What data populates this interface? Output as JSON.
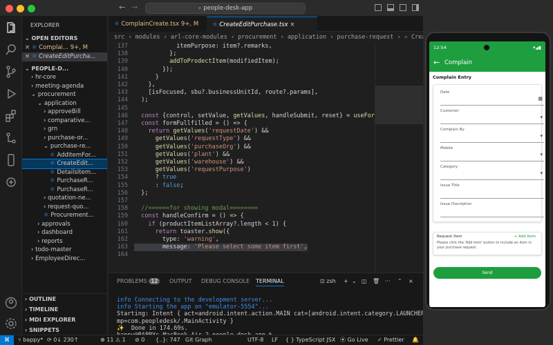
{
  "titlebar": {
    "search": "people-desk-app",
    "back": "←",
    "forward": "→"
  },
  "explorer": {
    "header": "EXPLORER",
    "open_editors": "OPEN EDITORS",
    "open_files": [
      {
        "name": "Complai...",
        "badge": "9+, M"
      },
      {
        "name": "CreateEditPurcha...",
        "badge": ""
      }
    ],
    "project": "PEOPLE-D...",
    "tree": [
      {
        "indent": 1,
        "icon": "›",
        "label": "hr-core"
      },
      {
        "indent": 1,
        "icon": "›",
        "label": "meeting-agenda"
      },
      {
        "indent": 1,
        "icon": "⌄",
        "label": "procurement"
      },
      {
        "indent": 2,
        "icon": "⌄",
        "label": "application"
      },
      {
        "indent": 3,
        "icon": "›",
        "label": "approveBill"
      },
      {
        "indent": 3,
        "icon": "›",
        "label": "comparative..."
      },
      {
        "indent": 3,
        "icon": "›",
        "label": "grn"
      },
      {
        "indent": 3,
        "icon": "›",
        "label": "purchase-or..."
      },
      {
        "indent": 3,
        "icon": "⌄",
        "label": "purchase-re..."
      },
      {
        "indent": 4,
        "icon": "",
        "label": "AddItemFor..."
      },
      {
        "indent": 4,
        "icon": "",
        "label": "CreateEdit..."
      },
      {
        "indent": 4,
        "icon": "",
        "label": "DetailsItem..."
      },
      {
        "indent": 4,
        "icon": "",
        "label": "PurchaseR..."
      },
      {
        "indent": 4,
        "icon": "",
        "label": "PurchaseR..."
      },
      {
        "indent": 3,
        "icon": "›",
        "label": "quotation-ne..."
      },
      {
        "indent": 3,
        "icon": "›",
        "label": "request-quo..."
      },
      {
        "indent": 3,
        "icon": "",
        "label": "Procurement..."
      },
      {
        "indent": 2,
        "icon": "›",
        "label": "approvals"
      },
      {
        "indent": 2,
        "icon": "›",
        "label": "dashboard"
      },
      {
        "indent": 2,
        "icon": "›",
        "label": "reports"
      },
      {
        "indent": 1,
        "icon": "›",
        "label": "todo-master"
      },
      {
        "indent": 1,
        "icon": "›",
        "label": "EmployeeDirec..."
      }
    ],
    "sections": [
      "OUTLINE",
      "TIMELINE",
      "MDI EXPLORER",
      "SNIPPETS"
    ]
  },
  "tabs": [
    {
      "label": "ComplainCreate.tsx",
      "badge": "9+, M"
    },
    {
      "label": "CreateEditPurchase.tsx",
      "badge": ""
    }
  ],
  "breadcrumb": [
    "src",
    "modules",
    "arl-core-modules",
    "procurement",
    "application",
    "purchase-request",
    "CreateEditPurchase..."
  ],
  "code": {
    "lines": [
      "137",
      "138",
      "139",
      "140",
      "141",
      "142",
      "143",
      "144",
      "145",
      "146",
      "147",
      "148",
      "149",
      "150",
      "151",
      "152",
      "153",
      "154",
      "155",
      "156",
      "157",
      "158",
      "159",
      "160",
      "161",
      "162",
      "163",
      "164"
    ],
    "text": [
      "            itemPurpose: item?.remarks,",
      "          };",
      "          addToProdectItem(modifiedItem);",
      "        });",
      "      }",
      "    },",
      "    [isFocused, sbu?.businessUnitId, route?.params],",
      "  );",
      "",
      "  const {control, setValue, getValues, handleSubmit, reset} = useForm();",
      "  const formFullfilled = () => {",
      "    return getValues('requestDate') &&",
      "      getValues('requestType') &&",
      "      getValues('purchaseOrg') &&",
      "      getValues('plant') &&",
      "      getValues('warehouse') &&",
      "      getValues('requestPurpose')",
      "      ? true",
      "      : false;",
      "  };",
      "",
      "  //======for showing modal========",
      "  const handleConfirm = () => {",
      "    if (productItemListArray?.length < 1) {",
      "      return toaster.show({",
      "        type: 'warning',",
      "        message: 'Please select some item first',",
      ""
    ]
  },
  "panel": {
    "tabs": [
      "PROBLEMS",
      "OUTPUT",
      "DEBUG CONSOLE",
      "TERMINAL"
    ],
    "problems_count": "12",
    "shell": "zsh",
    "terminal": [
      "info Connecting to the development server...",
      "info Starting the app on \"emulator-5554\"...",
      "Starting: Intent { act=android.intent.action.MAIN cat=[android.intent.category.LAUNCHER] c",
      "mp=com.peopledesk/.MainActivity }",
      "✨  Done in 174.69s.",
      "bappy@BAPPYs-MacBook-Air-2 people-desk-app % "
    ]
  },
  "status": {
    "branch": "bappy*",
    "sync": "⟳ 0↓ 230↑",
    "errors": "⊗ 11 ⚠ 1",
    "warnings": "⊘ 0",
    "position": "{..}: 747",
    "git": "Git Graph",
    "encoding": "UTF-8",
    "eol": "LF",
    "lang": "{ } TypeScript JSX",
    "golive": "Go Live",
    "prettier": "✓ Prettier"
  },
  "phone": {
    "time": "12:54",
    "app_title": "Complain",
    "section": "Complain Entry",
    "fields": [
      {
        "label": "Date",
        "icon": "calendar"
      },
      {
        "label": "Customer",
        "icon": "dropdown"
      },
      {
        "label": "Complain By",
        "icon": "dropdown"
      },
      {
        "label": "Mobile",
        "icon": "dropdown"
      },
      {
        "label": "Category",
        "icon": "dropdown"
      },
      {
        "label": "Issue Title",
        "icon": ""
      },
      {
        "label": "Issue Discription",
        "icon": ""
      }
    ],
    "request_item": "Request Item",
    "add_item": "+ Add Item",
    "hint": "Please click the 'Add item' button to include an item in your purchase request.",
    "send": "Send"
  },
  "colors": {
    "accent": "#1e9e3e",
    "tab_active": "#1f1f1f",
    "selection": "#04395e"
  }
}
